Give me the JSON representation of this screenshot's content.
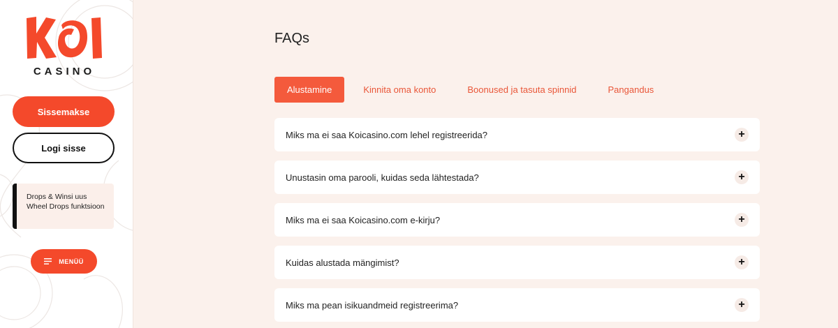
{
  "brand": {
    "logo_text": "KOI",
    "logo_subtext": "CASINO",
    "accent_color": "#f4492b"
  },
  "sidebar": {
    "deposit_label": "Sissemakse",
    "login_label": "Logi sisse",
    "promo_text": "Drops & Winsi uus Wheel Drops funktsioon",
    "menu_label": "MENÜÜ",
    "menu_icon": "hamburger-icon"
  },
  "main": {
    "title": "FAQs",
    "tabs": [
      {
        "label": "Alustamine",
        "active": true
      },
      {
        "label": "Kinnita oma konto",
        "active": false
      },
      {
        "label": "Boonused ja tasuta spinnid",
        "active": false
      },
      {
        "label": "Pangandus",
        "active": false
      }
    ],
    "faqs": [
      {
        "question": "Miks ma ei saa Koicasino.com lehel registreerida?",
        "toggle": "+"
      },
      {
        "question": "Unustasin oma parooli, kuidas seda lähtestada?",
        "toggle": "+"
      },
      {
        "question": "Miks ma ei saa Koicasino.com e-kirju?",
        "toggle": "+"
      },
      {
        "question": "Kuidas alustada mängimist?",
        "toggle": "+"
      },
      {
        "question": "Miks ma pean isikuandmeid registreerima?",
        "toggle": "+"
      }
    ]
  }
}
